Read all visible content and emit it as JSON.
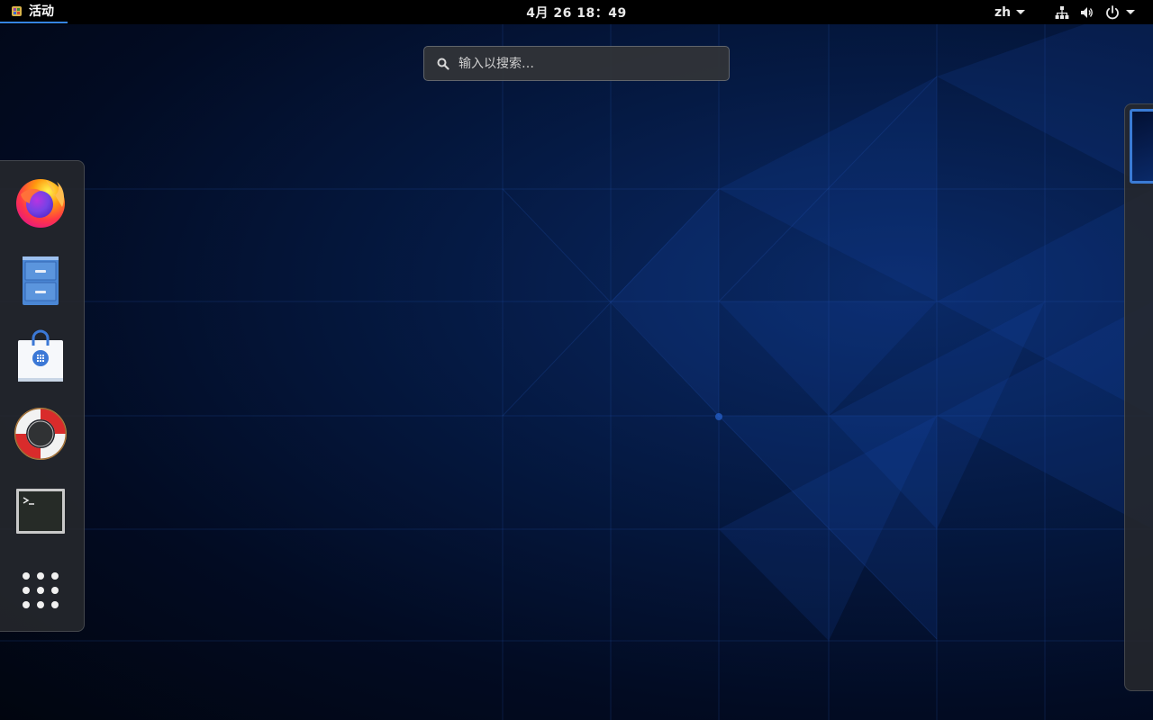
{
  "top_bar": {
    "activities_label": "活动",
    "clock": "4月 26  18：49",
    "language": "zh",
    "status_icons": [
      "network-wired-icon",
      "volume-icon",
      "power-icon"
    ]
  },
  "search": {
    "placeholder": "输入以搜索…",
    "value": ""
  },
  "dash": {
    "items": [
      {
        "name": "Firefox",
        "icon": "firefox-icon"
      },
      {
        "name": "Files",
        "icon": "file-cabinet-icon"
      },
      {
        "name": "Software",
        "icon": "software-bag-icon"
      },
      {
        "name": "Help",
        "icon": "lifebuoy-icon"
      },
      {
        "name": "Terminal",
        "icon": "terminal-icon"
      },
      {
        "name": "Show Applications",
        "icon": "app-grid-icon"
      }
    ]
  },
  "workspaces": {
    "count": 1,
    "active_index": 0
  },
  "colors": {
    "accent": "#3584e4",
    "top_bar": "#000000",
    "wallpaper_dark": "#01050f",
    "wallpaper_blue": "#0a2a68"
  }
}
